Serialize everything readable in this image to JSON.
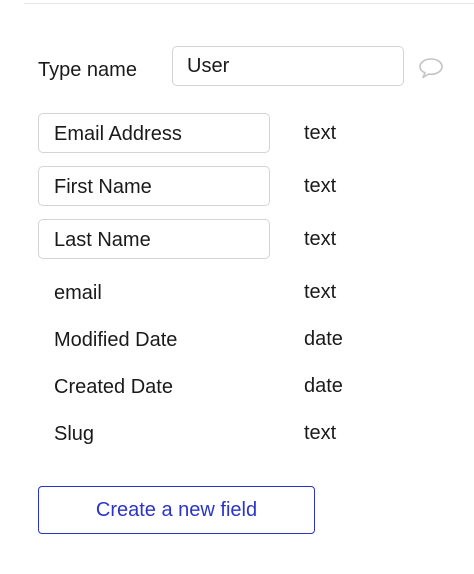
{
  "type_editor": {
    "type_label": "Type name",
    "type_name_value": "User",
    "comment_icon": "speech-bubble-icon"
  },
  "fields": [
    {
      "name": "Email Address",
      "type": "text",
      "editable": true
    },
    {
      "name": "First Name",
      "type": "text",
      "editable": true
    },
    {
      "name": "Last Name",
      "type": "text",
      "editable": true
    },
    {
      "name": "email",
      "type": "text",
      "editable": false
    },
    {
      "name": "Modified Date",
      "type": "date",
      "editable": false
    },
    {
      "name": "Created Date",
      "type": "date",
      "editable": false
    },
    {
      "name": "Slug",
      "type": "text",
      "editable": false
    }
  ],
  "create_field_label": "Create a new field",
  "colors": {
    "accent": "#2b34c9",
    "border": "#d4d4d4",
    "text": "#1a1a1a"
  }
}
